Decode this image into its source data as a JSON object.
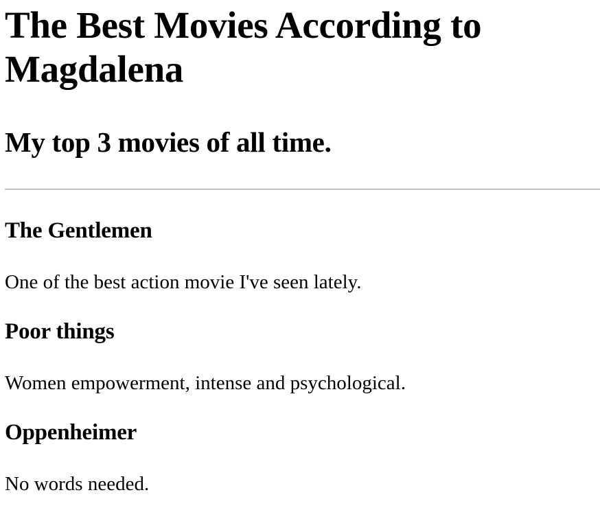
{
  "page": {
    "title": "The Best Movies According to Magdalena",
    "subtitle": "My top 3 movies of all time."
  },
  "movies": [
    {
      "title": "The Gentlemen",
      "description": "One of the best action movie I've seen lately."
    },
    {
      "title": "Poor things",
      "description": "Women empowerment, intense and psychological."
    },
    {
      "title": "Oppenheimer",
      "description": "No words needed."
    }
  ]
}
